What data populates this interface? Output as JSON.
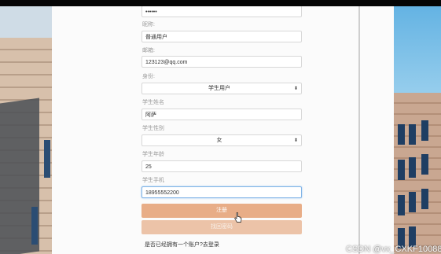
{
  "form": {
    "password": {
      "value": "••••••"
    },
    "nickname": {
      "label": "昵称:",
      "value": "普通用户"
    },
    "email": {
      "label": "邮箱:",
      "value": "123123@qq.com"
    },
    "role": {
      "label": "身份:",
      "value": "学生用户"
    },
    "student_name": {
      "label": "学生姓名",
      "value": "阿萨"
    },
    "student_gender": {
      "label": "学生性别",
      "value": "女"
    },
    "student_age": {
      "label": "学生年龄",
      "value": "25"
    },
    "student_phone": {
      "label": "学生手机",
      "value": "18955552200"
    },
    "register_button": "注册",
    "back_button": "找回密码",
    "login_prompt": "是否已经拥有一个账户?去登录"
  },
  "icons": {
    "select_arrow": "⬍",
    "cursor": "hand-pointer-icon"
  },
  "colors": {
    "primary_button": "#e8ad87",
    "secondary_button": "#ecc3a8",
    "focus_border": "#7fb3e6"
  },
  "watermark": "CSDN @vx_CXKF10088"
}
